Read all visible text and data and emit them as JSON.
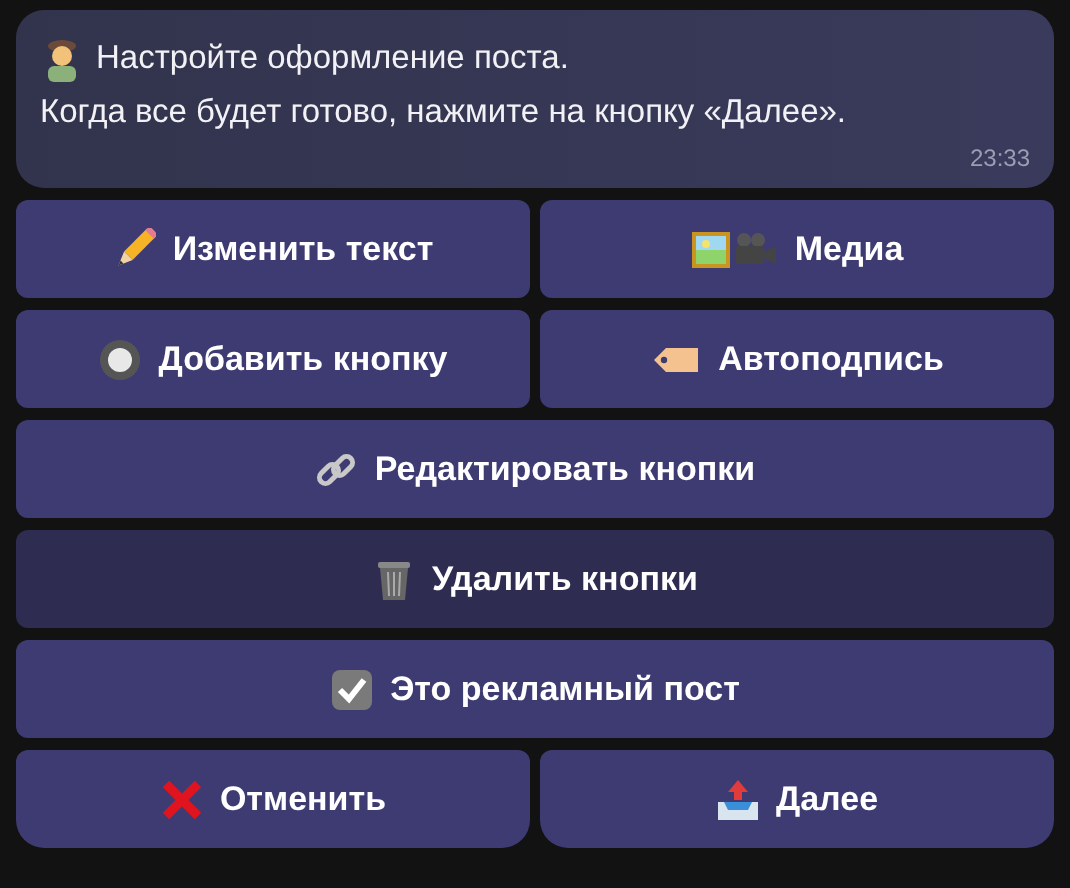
{
  "message": {
    "lines": [
      "Настройте оформление поста.",
      "Когда все будет готово, нажмите на кнопку «Далее»."
    ],
    "time": "23:33"
  },
  "keyboard": [
    [
      {
        "label": "Изменить текст",
        "kind": "pencil",
        "pressed": false
      },
      {
        "label": "Медиа",
        "kind": "media",
        "pressed": false
      }
    ],
    [
      {
        "label": "Добавить кнопку",
        "kind": "radio",
        "pressed": false
      },
      {
        "label": "Автоподпись",
        "kind": "tag",
        "pressed": false
      }
    ],
    [
      {
        "label": "Редактировать кнопки",
        "kind": "link",
        "pressed": false
      }
    ],
    [
      {
        "label": "Удалить кнопки",
        "kind": "trash",
        "pressed": true
      }
    ],
    [
      {
        "label": "Это рекламный пост",
        "kind": "checkbox",
        "checked": true,
        "pressed": false
      }
    ],
    [
      {
        "label": "Отменить",
        "kind": "cross",
        "pressed": false
      },
      {
        "label": "Далее",
        "kind": "outbox",
        "pressed": false
      }
    ]
  ]
}
